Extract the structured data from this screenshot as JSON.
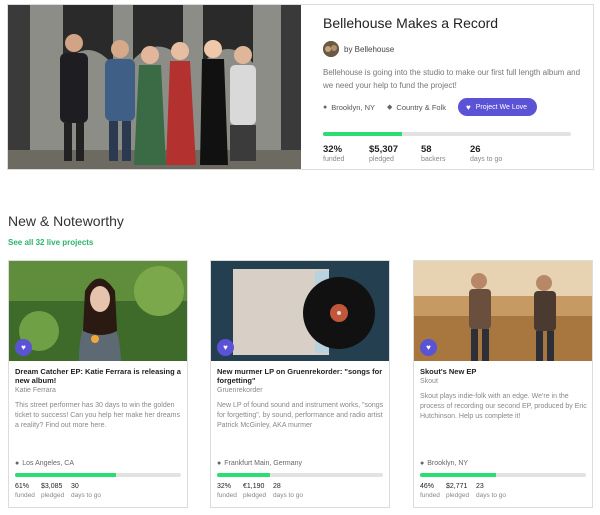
{
  "featured": {
    "title": "Bellehouse Makes a Record",
    "byline": "by Bellehouse",
    "description": "Bellehouse is going into the studio to make our first full length album and we need your help to fund the project!",
    "location": "Brooklyn, NY",
    "category": "Country & Folk",
    "badge": "Project We Love",
    "progress": 0.32,
    "stats": [
      {
        "value": "32%",
        "label": "funded"
      },
      {
        "value": "$5,307",
        "label": "pledged"
      },
      {
        "value": "58",
        "label": "backers"
      },
      {
        "value": "26",
        "label": "days to go"
      }
    ]
  },
  "section": {
    "title": "New & Noteworthy",
    "link": "See all 32 live projects"
  },
  "cards": [
    {
      "title": "Dream Catcher EP: Katie Ferrara is releasing a new album!",
      "creator": "Katie Ferrara",
      "description": "This street performer has 30 days to win the golden ticket to success! Can you help her make her dreams a reality? Find out more here.",
      "location": "Los Angeles, CA",
      "progress": 0.61,
      "stats": [
        {
          "value": "61%",
          "label": "funded"
        },
        {
          "value": "$3,085",
          "label": "pledged"
        },
        {
          "value": "30",
          "label": "days to go"
        }
      ]
    },
    {
      "title": "New murmer LP on Gruenrekorder: \"songs for forgetting\"",
      "creator": "Gruenrekorder",
      "description": "New LP of found sound and instrument works, \"songs for forgetting\", by sound, performance and radio artist Patrick McGinley, AKA murmer",
      "location": "Frankfurt Main, Germany",
      "progress": 0.32,
      "stats": [
        {
          "value": "32%",
          "label": "funded"
        },
        {
          "value": "€1,190",
          "label": "pledged"
        },
        {
          "value": "28",
          "label": "days to go"
        }
      ]
    },
    {
      "title": "Skout's New EP",
      "creator": "Skout",
      "description": "Skout plays indie-folk with an edge. We're in the process of recording our second EP, produced by Eric Hutchinson. Help us complete it!",
      "location": "Brooklyn, NY",
      "progress": 0.46,
      "stats": [
        {
          "value": "46%",
          "label": "funded"
        },
        {
          "value": "$2,771",
          "label": "pledged"
        },
        {
          "value": "23",
          "label": "days to go"
        }
      ]
    }
  ],
  "icons": {
    "location": "map-pin-icon",
    "category": "tag-icon",
    "love": "heart-icon"
  },
  "colors": {
    "accent": "#5a53d6",
    "progress": "#2bde73",
    "link": "#2bb46b"
  }
}
